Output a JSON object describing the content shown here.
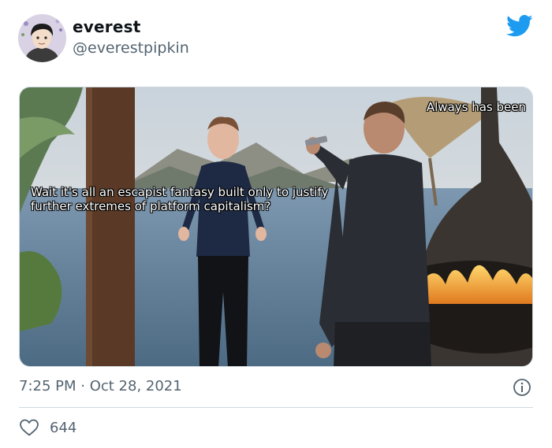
{
  "author": {
    "display_name": "everest",
    "handle": "@everestpipkin",
    "avatar_icon": "avatar-cartoon-icon"
  },
  "brand": {
    "icon": "twitter-bird-icon",
    "color": "#1d9bf0"
  },
  "media": {
    "caption_left": "Wait it's all an escapist fantasy built only to justify further extremes of platform capitalism?",
    "caption_right": "Always has been"
  },
  "meta": {
    "timestamp": "7:25 PM · Oct 28, 2021"
  },
  "actions": {
    "like_count": "644",
    "like_icon": "heart-icon",
    "info_icon": "info-icon"
  },
  "colors": {
    "text": "#0f1419",
    "secondary": "#536471",
    "border": "#cfd9de"
  }
}
